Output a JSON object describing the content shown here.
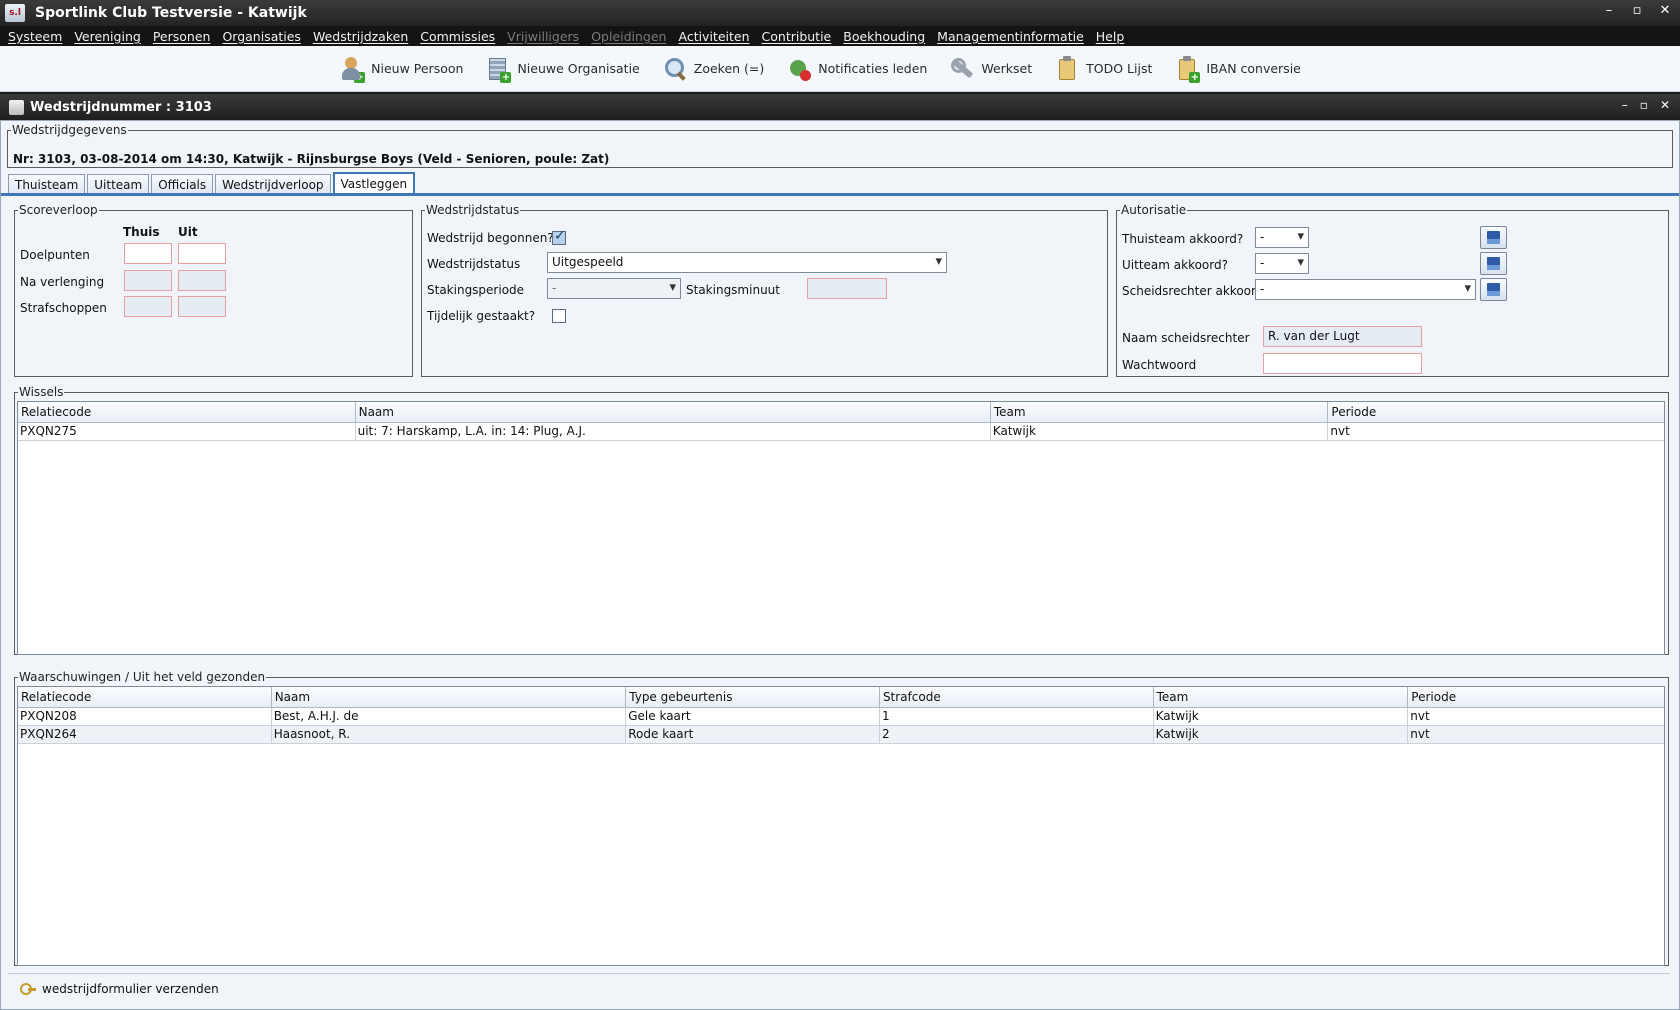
{
  "app": {
    "title": "Sportlink Club Testversie - Katwijk",
    "logo_text": "s.l"
  },
  "window_controls": {
    "minimize": "–",
    "restore": "▫",
    "close": "✕"
  },
  "menu": [
    {
      "label": "Systeem",
      "enabled": true
    },
    {
      "label": "Vereniging",
      "enabled": true
    },
    {
      "label": "Personen",
      "enabled": true
    },
    {
      "label": "Organisaties",
      "enabled": true
    },
    {
      "label": "Wedstrijdzaken",
      "enabled": true
    },
    {
      "label": "Commissies",
      "enabled": true
    },
    {
      "label": "Vrijwilligers",
      "enabled": false
    },
    {
      "label": "Opleidingen",
      "enabled": false
    },
    {
      "label": "Activiteiten",
      "enabled": true
    },
    {
      "label": "Contributie",
      "enabled": true
    },
    {
      "label": "Boekhouding",
      "enabled": true
    },
    {
      "label": "Managementinformatie",
      "enabled": true
    },
    {
      "label": "Help",
      "enabled": true
    }
  ],
  "toolbar": [
    {
      "label": "Nieuw Persoon",
      "icon": "new-person-icon"
    },
    {
      "label": "Nieuwe Organisatie",
      "icon": "new-organisation-icon"
    },
    {
      "label": "Zoeken (=)",
      "icon": "search-icon"
    },
    {
      "label": "Notificaties leden",
      "icon": "notification-icon"
    },
    {
      "label": "Werkset",
      "icon": "wrench-icon"
    },
    {
      "label": "TODO Lijst",
      "icon": "clipboard-icon"
    },
    {
      "label": "IBAN conversie",
      "icon": "iban-clipboard-icon"
    }
  ],
  "frame": {
    "title": "Wedstrijdnummer : 3103"
  },
  "wedstrijdgegevens": {
    "legend": "Wedstrijdgegevens",
    "text": "Nr: 3103, 03-08-2014 om 14:30, Katwijk - Rijnsburgse Boys (Veld - Senioren, poule: Zat)"
  },
  "tabs": [
    {
      "label": "Thuisteam",
      "active": false
    },
    {
      "label": "Uitteam",
      "active": false
    },
    {
      "label": "Officials",
      "active": false
    },
    {
      "label": "Wedstrijdverloop",
      "active": false
    },
    {
      "label": "Vastleggen",
      "active": true
    }
  ],
  "scoreverloop": {
    "legend": "Scoreverloop",
    "col_thuis": "Thuis",
    "col_uit": "Uit",
    "rows": [
      "Doelpunten",
      "Na verlenging",
      "Strafschoppen"
    ]
  },
  "wedstrijdstatus": {
    "legend": "Wedstrijdstatus",
    "begonnen_label": "Wedstrijd begonnen?",
    "status_label": "Wedstrijdstatus",
    "status_value": "Uitgespeeld",
    "stakingsperiode_label": "Stakingsperiode",
    "stakingsperiode_value": "-",
    "stakingsminuut_label": "Stakingsminuut",
    "gestaakt_label": "Tijdelijk gestaakt?"
  },
  "autorisatie": {
    "legend": "Autorisatie",
    "thuisteam_label": "Thuisteam akkoord?",
    "thuisteam_value": "-",
    "uitteam_label": "Uitteam akkoord?",
    "uitteam_value": "-",
    "scheids_label": "Scheidsrechter akkoord?",
    "scheids_value": "-",
    "naam_label": "Naam scheidsrechter",
    "naam_value": "R. van der Lugt",
    "wachtwoord_label": "Wachtwoord"
  },
  "wissels": {
    "legend": "Wissels",
    "headers": [
      "Relatiecode",
      "Naam",
      "Team",
      "Periode"
    ],
    "rows": [
      [
        "PXQN275",
        "uit: 7: Harskamp, L.A.  in: 14: Plug, A.J.",
        "Katwijk",
        "nvt"
      ]
    ]
  },
  "waarschuwingen": {
    "legend": "Waarschuwingen / Uit het veld gezonden",
    "headers": [
      "Relatiecode",
      "Naam",
      "Type gebeurtenis",
      "Strafcode",
      "Team",
      "Periode"
    ],
    "rows": [
      [
        "PXQN208",
        "Best, A.H.J. de",
        "Gele kaart",
        "1",
        "Katwijk",
        "nvt"
      ],
      [
        "PXQN264",
        "Haasnoot, R.",
        "Rode kaart",
        "2",
        "Katwijk",
        "nvt"
      ]
    ]
  },
  "footer": {
    "action_label": "wedstrijdformulier verzenden"
  }
}
